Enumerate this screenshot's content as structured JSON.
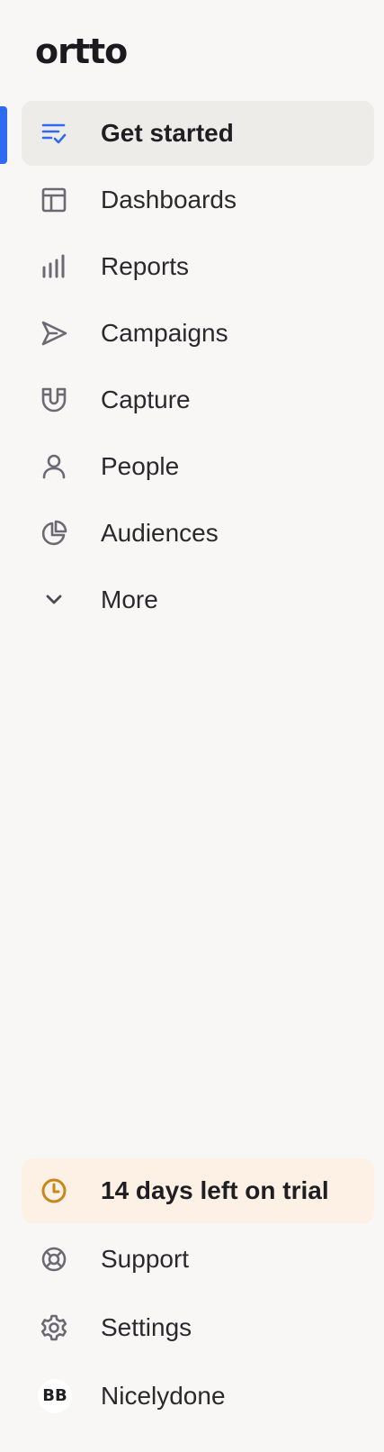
{
  "app": {
    "logo_text": "ortto"
  },
  "nav": {
    "items": [
      {
        "label": "Get started",
        "icon": "list-check-icon",
        "active": true
      },
      {
        "label": "Dashboards",
        "icon": "layout-icon"
      },
      {
        "label": "Reports",
        "icon": "bar-chart-icon"
      },
      {
        "label": "Campaigns",
        "icon": "send-icon"
      },
      {
        "label": "Capture",
        "icon": "magnet-icon"
      },
      {
        "label": "People",
        "icon": "user-icon"
      },
      {
        "label": "Audiences",
        "icon": "pie-chart-icon"
      },
      {
        "label": "More",
        "icon": "chevron-down-icon"
      }
    ]
  },
  "footer": {
    "trial_label": "14 days left on trial",
    "support_label": "Support",
    "settings_label": "Settings",
    "account_name": "Nicelydone",
    "avatar_initials": "BB"
  },
  "colors": {
    "accent": "#2d6bf0",
    "icon": "#6b6a72",
    "trial": "#c8871a",
    "active_bg": "#eeece8",
    "trial_bg": "#fdf1e5",
    "background": "#f8f7f5"
  }
}
